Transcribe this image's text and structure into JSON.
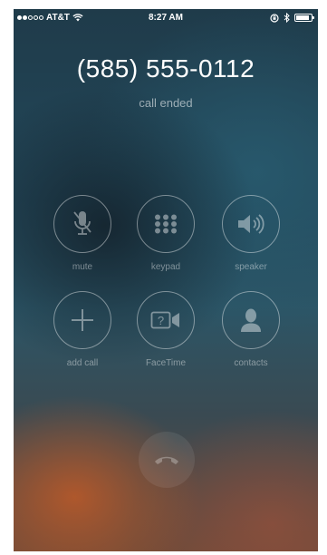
{
  "status_bar": {
    "carrier": "AT&T",
    "time": "8:27 AM",
    "signal_filled": 2,
    "signal_total": 5,
    "icons": [
      "wifi-icon",
      "orientation-lock-icon",
      "bluetooth-icon",
      "battery-icon"
    ]
  },
  "call": {
    "number": "(585) 555-0112",
    "status": "call ended"
  },
  "buttons": [
    {
      "label": "mute",
      "icon": "mic-off-icon"
    },
    {
      "label": "keypad",
      "icon": "keypad-icon"
    },
    {
      "label": "speaker",
      "icon": "speaker-icon"
    },
    {
      "label": "add call",
      "icon": "plus-icon"
    },
    {
      "label": "FaceTime",
      "icon": "facetime-icon"
    },
    {
      "label": "contacts",
      "icon": "contacts-icon"
    }
  ],
  "end_call": {
    "icon": "end-call-icon"
  }
}
